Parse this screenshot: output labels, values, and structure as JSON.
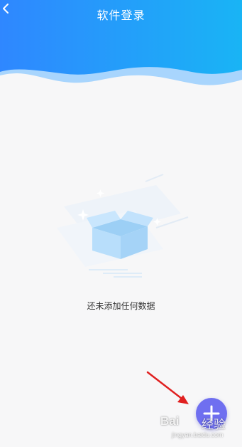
{
  "header": {
    "title": "软件登录",
    "back_icon": "chevron-left-icon",
    "gradient_start": "#2f87ff",
    "gradient_end": "#19b4f5"
  },
  "empty_state": {
    "icon": "empty-box-icon",
    "message": "还未添加任何数据"
  },
  "fab": {
    "icon": "plus-icon",
    "color": "#6f6ff0"
  },
  "annotation": {
    "arrow_color": "#e02020"
  },
  "watermark": {
    "logo": "Bai",
    "label": "经验",
    "url": "jingyan.baidu.com"
  }
}
